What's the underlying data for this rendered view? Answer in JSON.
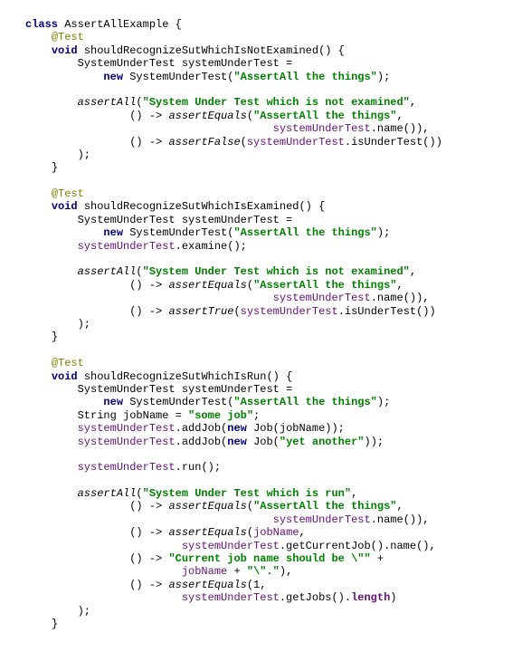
{
  "code": {
    "class_kw": "class",
    "class_name": "AssertAllExample {",
    "test_ann": "@Test",
    "void_kw": "void",
    "m1_sig": "shouldRecognizeSutWhichIsNotExamined() {",
    "sut_type": "SystemUnderTest ",
    "sut_decl": "systemUnderTest =",
    "new_kw": "new",
    "sut_ctor": "SystemUnderTest(",
    "str_title": "\"AssertAll the things\"",
    "close_paren_semi": ");",
    "assertAll": "assertAll",
    "open_paren": "(",
    "str_not_examined": "\"System Under Test which is not examined\"",
    "comma": ",",
    "lambda": "() -> ",
    "assertEquals": "assertEquals",
    "sut_var": "systemUnderTest",
    "dot_name": ".name()),",
    "assertFalse": "assertFalse",
    "assertTrue": "assertTrue",
    "dot_isUnderTest": ".isUnderTest())",
    "close_brace": "}",
    "m2_sig": "shouldRecognizeSutWhichIsExamined() {",
    "dot_examine": ".examine();",
    "m3_sig": "shouldRecognizeSutWhichIsRun() {",
    "string_type": "String jobName = ",
    "str_somejob": "\"some job\"",
    "semi": ";",
    "dot_addJob": ".addJob(",
    "job_ctor": "Job(jobName));",
    "job_ctor2": "Job(",
    "str_yetanother": "\"yet another\"",
    "close2": "));",
    "dot_run": ".run();",
    "str_is_run": "\"System Under Test which is run\"",
    "jobName_var": "jobName",
    "dot_getCurrent": ".getCurrentJob().name(),",
    "str_curjob_msg": "\"Current job name should be \\\"\"",
    "plus": " + ",
    "str_escq": "\"\\\".\"",
    "close_paren_comma": "),",
    "one": "(1,",
    "dot_getJobs": ".getJobs().",
    "length_fld": "length",
    "close_paren_only": ")"
  }
}
